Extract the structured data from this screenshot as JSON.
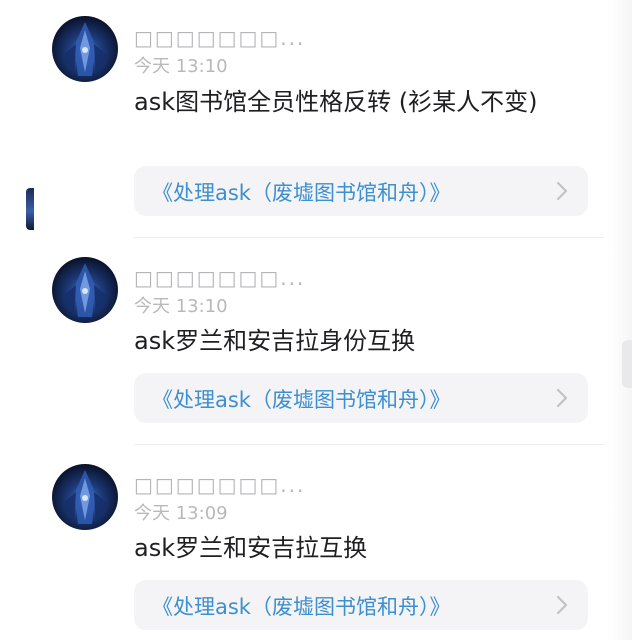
{
  "posts": [
    {
      "username": "□□□□□□□...",
      "time": "今天 13:10",
      "content": "ask图书馆全员性格反转 (衫某人不变)",
      "link": "《处理ask（废墟图书馆和舟）》"
    },
    {
      "username": "□□□□□□□...",
      "time": "今天 13:10",
      "content": "ask罗兰和安吉拉身份互换",
      "link": "《处理ask（废墟图书馆和舟）》"
    },
    {
      "username": "□□□□□□□...",
      "time": "今天 13:09",
      "content": "ask罗兰和安吉拉互换",
      "link": "《处理ask（废墟图书馆和舟）》"
    }
  ],
  "icons": {
    "avatar": "avatar-image",
    "chevron": "chevron-right-icon"
  },
  "colors": {
    "link": "#3c8fd0",
    "meta": "#b5b5b8",
    "card_bg": "#f4f4f6"
  }
}
